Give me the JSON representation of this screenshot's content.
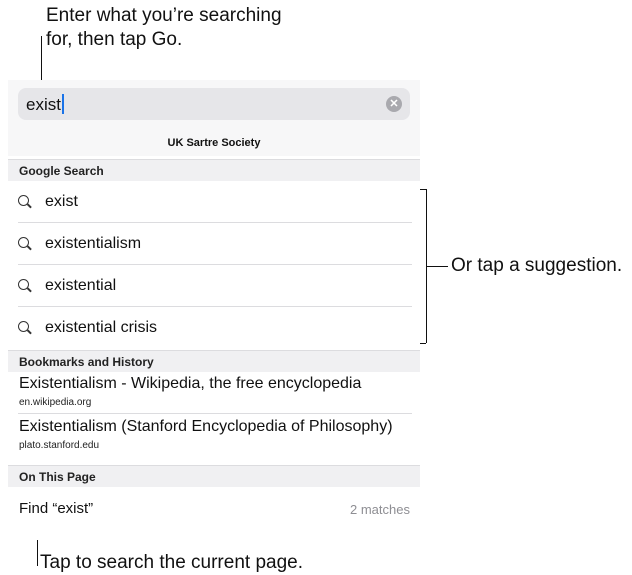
{
  "callouts": {
    "top_line1": "Enter what you’re searching",
    "top_line2": "for, then tap Go.",
    "right": "Or tap a suggestion.",
    "bottom": "Tap to search the current page."
  },
  "search": {
    "value": "exist",
    "site_name": "UK Sartre Society"
  },
  "sections": {
    "google": "Google Search",
    "bookmarks": "Bookmarks and History",
    "on_page": "On This Page"
  },
  "suggestions": [
    "exist",
    "existentialism",
    "existential",
    "existential crisis"
  ],
  "bookmarks": [
    {
      "title": "Existentialism - Wikipedia, the free encyclopedia",
      "url": "en.wikipedia.org"
    },
    {
      "title": "Existentialism (Stanford Encyclopedia of Philosophy)",
      "url": "plato.stanford.edu"
    }
  ],
  "find": {
    "label": "Find “exist”",
    "matches": "2 matches"
  }
}
